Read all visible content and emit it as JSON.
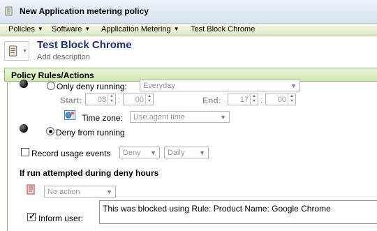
{
  "window": {
    "title": "New Application metering policy",
    "icon": "policy-scroll-icon"
  },
  "menu": [
    {
      "label": "Policies",
      "has_arrow": true
    },
    {
      "label": "Software",
      "has_arrow": true
    },
    {
      "label": "Application Metering",
      "has_arrow": true
    },
    {
      "label": "Test Block Chrome",
      "has_arrow": false
    }
  ],
  "policy": {
    "title": "Test Block Chrome",
    "description_placeholder": "Add description"
  },
  "section_title": "Policy Rules/Actions",
  "only_deny": {
    "label": "Only deny running:",
    "schedule_value": "Everyday",
    "start_label": "Start:",
    "start_hour": "08",
    "start_minute": "00",
    "end_label": "End:",
    "end_hour": "17",
    "end_minute": "00",
    "timezone_label": "Time zone:",
    "timezone_value": "Use agent time"
  },
  "deny_from_running": {
    "label": "Deny from running",
    "selected": true
  },
  "record_usage": {
    "label": "Record usage events",
    "type_value": "Deny",
    "interval_value": "Daily",
    "checked": false
  },
  "attempt_section": {
    "title": "If run attempted during deny hours",
    "action_value": "No action"
  },
  "inform_user": {
    "label": "Inform user:",
    "checked": true,
    "message": "This was blocked using Rule: Product Name: Google Chrome"
  }
}
